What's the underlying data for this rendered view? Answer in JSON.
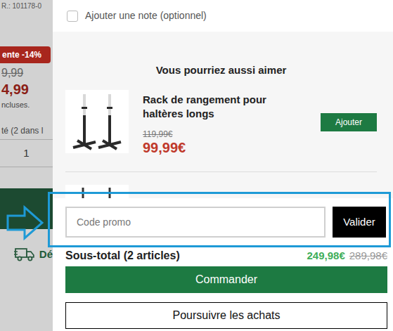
{
  "background_page": {
    "reference": "R.: 101178-0",
    "badge": "ente -14%",
    "old_price": "9,99",
    "price": "4,99",
    "tax_note": "ncluses.",
    "quantity_label": "té (2 dans l",
    "quantity": "1",
    "delivery_label": "Dé"
  },
  "cart_drawer": {
    "note": {
      "label": "Ajouter une note (optionnel)",
      "checked": false
    },
    "recommendations": {
      "title": "Vous pourriez aussi aimer",
      "items": [
        {
          "name": "Rack de rangement pour haltères longs",
          "old_price": "119,99€",
          "price": "99,99€",
          "button": "Ajouter"
        }
      ]
    },
    "promo": {
      "placeholder": "Code promo",
      "button": "Valider"
    },
    "subtotal": {
      "label": "Sous-total (2 articles)",
      "price": "249,98€",
      "old_price": "289,98€"
    },
    "buttons": [
      "Commander",
      "Poursuivre les achats"
    ]
  }
}
